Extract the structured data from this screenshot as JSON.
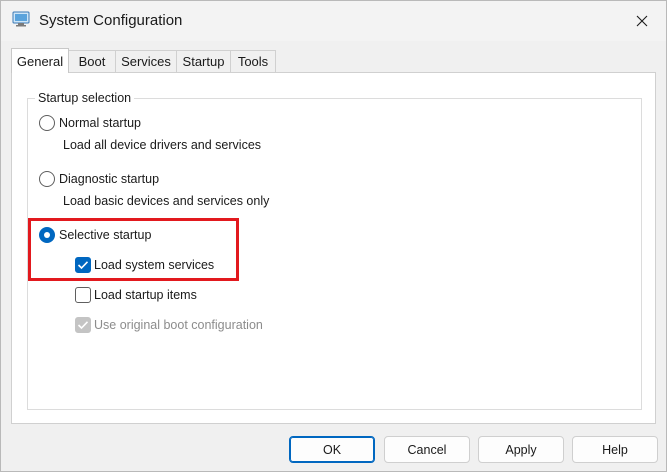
{
  "window": {
    "title": "System Configuration"
  },
  "tabs": [
    {
      "label": "General",
      "active": true
    },
    {
      "label": "Boot",
      "active": false
    },
    {
      "label": "Services",
      "active": false
    },
    {
      "label": "Startup",
      "active": false
    },
    {
      "label": "Tools",
      "active": false
    }
  ],
  "startup_selection": {
    "group_title": "Startup selection",
    "normal": {
      "label": "Normal startup",
      "description": "Load all device drivers and services",
      "selected": false
    },
    "diagnostic": {
      "label": "Diagnostic startup",
      "description": "Load basic devices and services only",
      "selected": false
    },
    "selective": {
      "label": "Selective startup",
      "selected": true,
      "options": {
        "load_system_services": {
          "label": "Load system services",
          "checked": true,
          "enabled": true
        },
        "load_startup_items": {
          "label": "Load startup items",
          "checked": false,
          "enabled": true
        },
        "use_original_boot": {
          "label": "Use original boot configuration",
          "checked": true,
          "enabled": false
        }
      }
    }
  },
  "buttons": {
    "ok": "OK",
    "cancel": "Cancel",
    "apply": "Apply",
    "help": "Help"
  },
  "colors": {
    "accent": "#0067c0",
    "highlight": "#e2191e"
  },
  "icons": {
    "app": "system-configuration-icon",
    "close": "close-icon",
    "check": "checkmark-icon"
  }
}
